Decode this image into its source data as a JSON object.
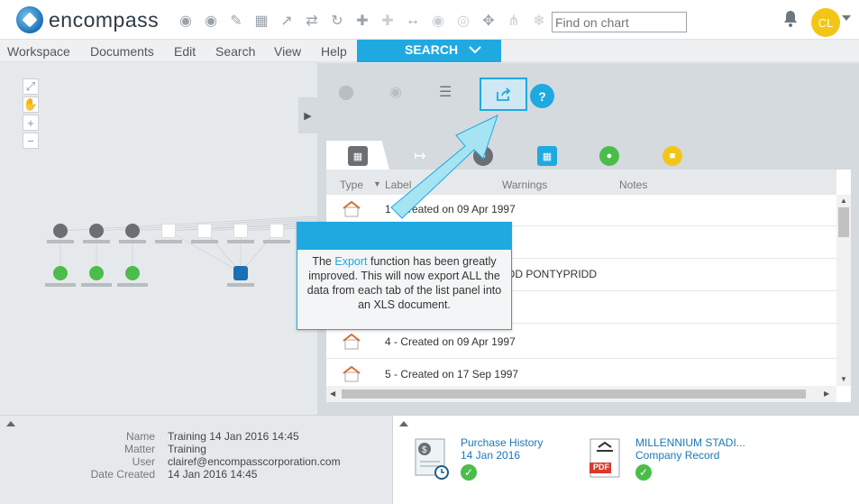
{
  "app": {
    "brand": "encompass"
  },
  "toolbar": {
    "find_placeholder": "Find on chart",
    "icons": [
      "camera-add-icon",
      "camera-icon",
      "edit-icon",
      "chart-edit-icon",
      "share-icon",
      "shuffle-icon",
      "refresh-icon",
      "expand-icon",
      "collapse-icon",
      "link-icon",
      "eye-icon",
      "eye-outline-icon",
      "move-icon",
      "tree-icon",
      "snowflake-icon"
    ]
  },
  "user": {
    "initials": "CL"
  },
  "menu": [
    "Workspace",
    "Documents",
    "Edit",
    "Search",
    "View",
    "Help"
  ],
  "search_tab": {
    "label": "SEARCH"
  },
  "panel": {
    "help_label": "?",
    "columns": [
      "Type",
      "Label",
      "Warnings",
      "Notes"
    ],
    "rows": [
      {
        "label": "1 - Created on 09 Apr 1997"
      },
      {
        "label": ""
      },
      {
        "label": "YNYDD PONTYPRIDD"
      },
      {
        "label": ""
      },
      {
        "label": "4 - Created on 09 Apr 1997"
      },
      {
        "label": "5 - Created on 17 Sep 1997"
      }
    ]
  },
  "callout": {
    "before": "The ",
    "highlight": "Export",
    "after": " function has been greatly improved. This will now export ALL the data from each tab of the list panel into an XLS document."
  },
  "workspace": {
    "name_key": "Name",
    "name_val": "Training 14 Jan 2016 14:45",
    "matter_key": "Matter",
    "matter_val": "Training",
    "user_key": "User",
    "user_val": "clairef@encompasscorporation.com",
    "created_key": "Date Created",
    "created_val": "14 Jan 2016 14:45"
  },
  "documents": [
    {
      "title": "Purchase History",
      "sub": "14 Jan 2016"
    },
    {
      "title": "MILLENNIUM STADI...",
      "sub": "Company Record",
      "badge": "PDF"
    }
  ],
  "colors": {
    "accent": "#1fa9e1",
    "success": "#4bbd4a",
    "avatar": "#f3c516"
  }
}
